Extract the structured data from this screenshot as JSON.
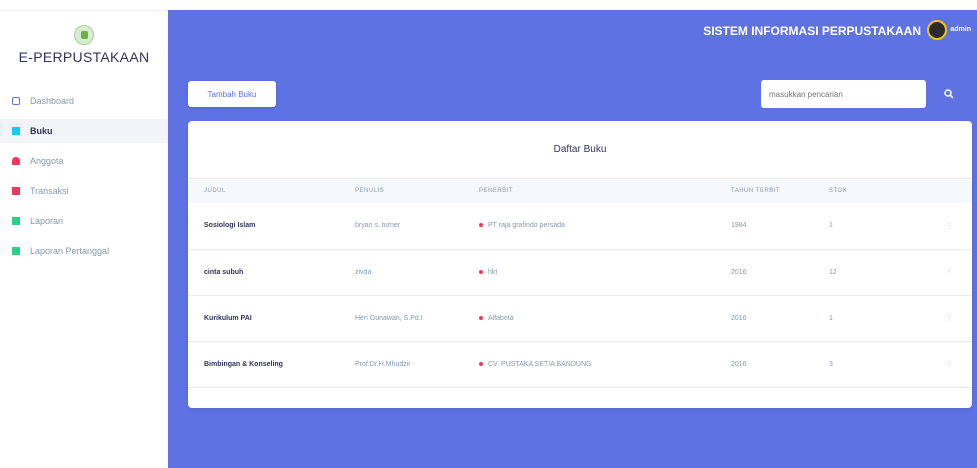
{
  "sidebar": {
    "brand": "E-PERPUSTAKAAN",
    "items": [
      {
        "label": "Dashboard",
        "icon": "dashboard-icon"
      },
      {
        "label": "Buku",
        "icon": "book-icon"
      },
      {
        "label": "Anggota",
        "icon": "user-icon"
      },
      {
        "label": "Transaksi",
        "icon": "transaction-icon"
      },
      {
        "label": "Laporan",
        "icon": "report-icon"
      },
      {
        "label": "Laporan Pertanggal",
        "icon": "report-date-icon"
      }
    ]
  },
  "header": {
    "title": "SISTEM INFORMASI PERPUSTAKAAN",
    "user": "admin"
  },
  "toolbar": {
    "add_label": "Tambah Buku",
    "search_placeholder": "masukkan pencarian"
  },
  "card": {
    "title": "Daftar Buku",
    "columns": [
      "Judul",
      "Penulis",
      "Penerbit",
      "Tahun Terbit",
      "Stok",
      ""
    ],
    "rows": [
      {
        "judul": "Sosiologi Islam",
        "penulis": "bryan s. turner",
        "penerbit": "PT raja grafindo persada",
        "tahun": "1984",
        "stok": "1"
      },
      {
        "judul": "cinta subuh",
        "penulis": "zivda",
        "penerbit": "hkt",
        "tahun": "2016",
        "stok": "12"
      },
      {
        "judul": "Kurikulum PAI",
        "penulis": "Heri Gunawan, S.Pd.I",
        "penerbit": "Alfabeta",
        "tahun": "2016",
        "stok": "1"
      },
      {
        "judul": "Bimbingan & Konseling",
        "penulis": "Prof.Dr.H.Mhudzir",
        "penerbit": "CV. PUSTAKA SETIA BANDUNG",
        "tahun": "2016",
        "stok": "3"
      }
    ]
  },
  "colors": {
    "primary": "#5e72e4",
    "danger": "#f5365c",
    "success": "#2dce89",
    "info": "#11cdef"
  }
}
